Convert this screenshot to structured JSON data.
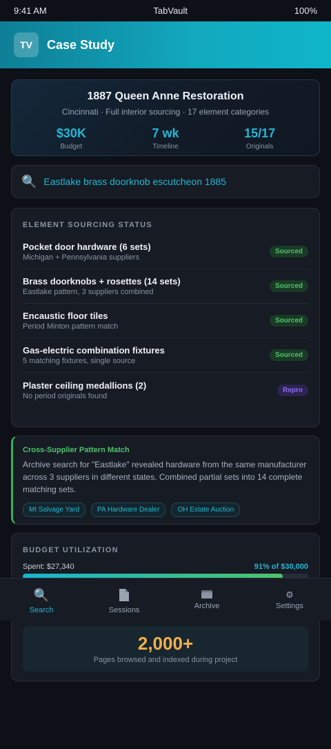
{
  "status_bar": {
    "time": "9:41 AM",
    "app": "TabVault",
    "battery": "100%"
  },
  "header": {
    "logo": "TV",
    "title": "Case Study"
  },
  "project": {
    "title": "1887 Queen Anne Restoration",
    "subtitle": "Cincinnati · Full interior sourcing · 17 element categories",
    "stats": [
      {
        "value": "$30K",
        "label": "Budget"
      },
      {
        "value": "7 wk",
        "label": "Timeline"
      },
      {
        "value": "15/17",
        "label": "Originals"
      }
    ]
  },
  "search": {
    "icon": "search-icon",
    "query": "Eastlake brass doorknob escutcheon 1885"
  },
  "sourcing": {
    "title": "ELEMENT SOURCING STATUS",
    "rows": [
      {
        "name": "Pocket door hardware (6 sets)",
        "detail": "Michigan + Pennsylvania suppliers",
        "status": "Sourced"
      },
      {
        "name": "Brass doorknobs + rosettes (14 sets)",
        "detail": "Eastlake pattern, 3 suppliers combined",
        "status": "Sourced"
      },
      {
        "name": "Encaustic floor tiles",
        "detail": "Period Minton pattern match",
        "status": "Sourced"
      },
      {
        "name": "Gas-electric combination fixtures",
        "detail": "5 matching fixtures, single source",
        "status": "Sourced"
      },
      {
        "name": "Plaster ceiling medallions (2)",
        "detail": "No period originals found",
        "status": "Repro"
      }
    ]
  },
  "insight": {
    "title": "Cross-Supplier Pattern Match",
    "body": "Archive search for \"Eastlake\" revealed hardware from the same manufacturer across 3 suppliers in different states. Combined partial sets into 14 complete matching sets.",
    "chips": [
      "MI Salvage Yard",
      "PA Hardware Dealer",
      "OH Estate Auction"
    ]
  },
  "budget": {
    "title": "BUDGET UTILIZATION",
    "spent": "Spent: $27,340",
    "percent_text": "91% of $30,000",
    "fraction": 0.91,
    "pages_value": "2,000+",
    "pages_label": "Pages browsed and indexed during project"
  },
  "nav": {
    "items": [
      {
        "icon": "search-icon",
        "label": "Search",
        "active": true
      },
      {
        "icon": "document-icon",
        "label": "Sessions"
      },
      {
        "icon": "archive-icon",
        "label": "Archive"
      },
      {
        "icon": "gear-icon",
        "label": "Settings"
      }
    ]
  },
  "colors": {
    "accent": "#22b7d3",
    "success": "#4fc26a",
    "repro": "#8b6cf0",
    "highlight": "#f2b04a"
  }
}
